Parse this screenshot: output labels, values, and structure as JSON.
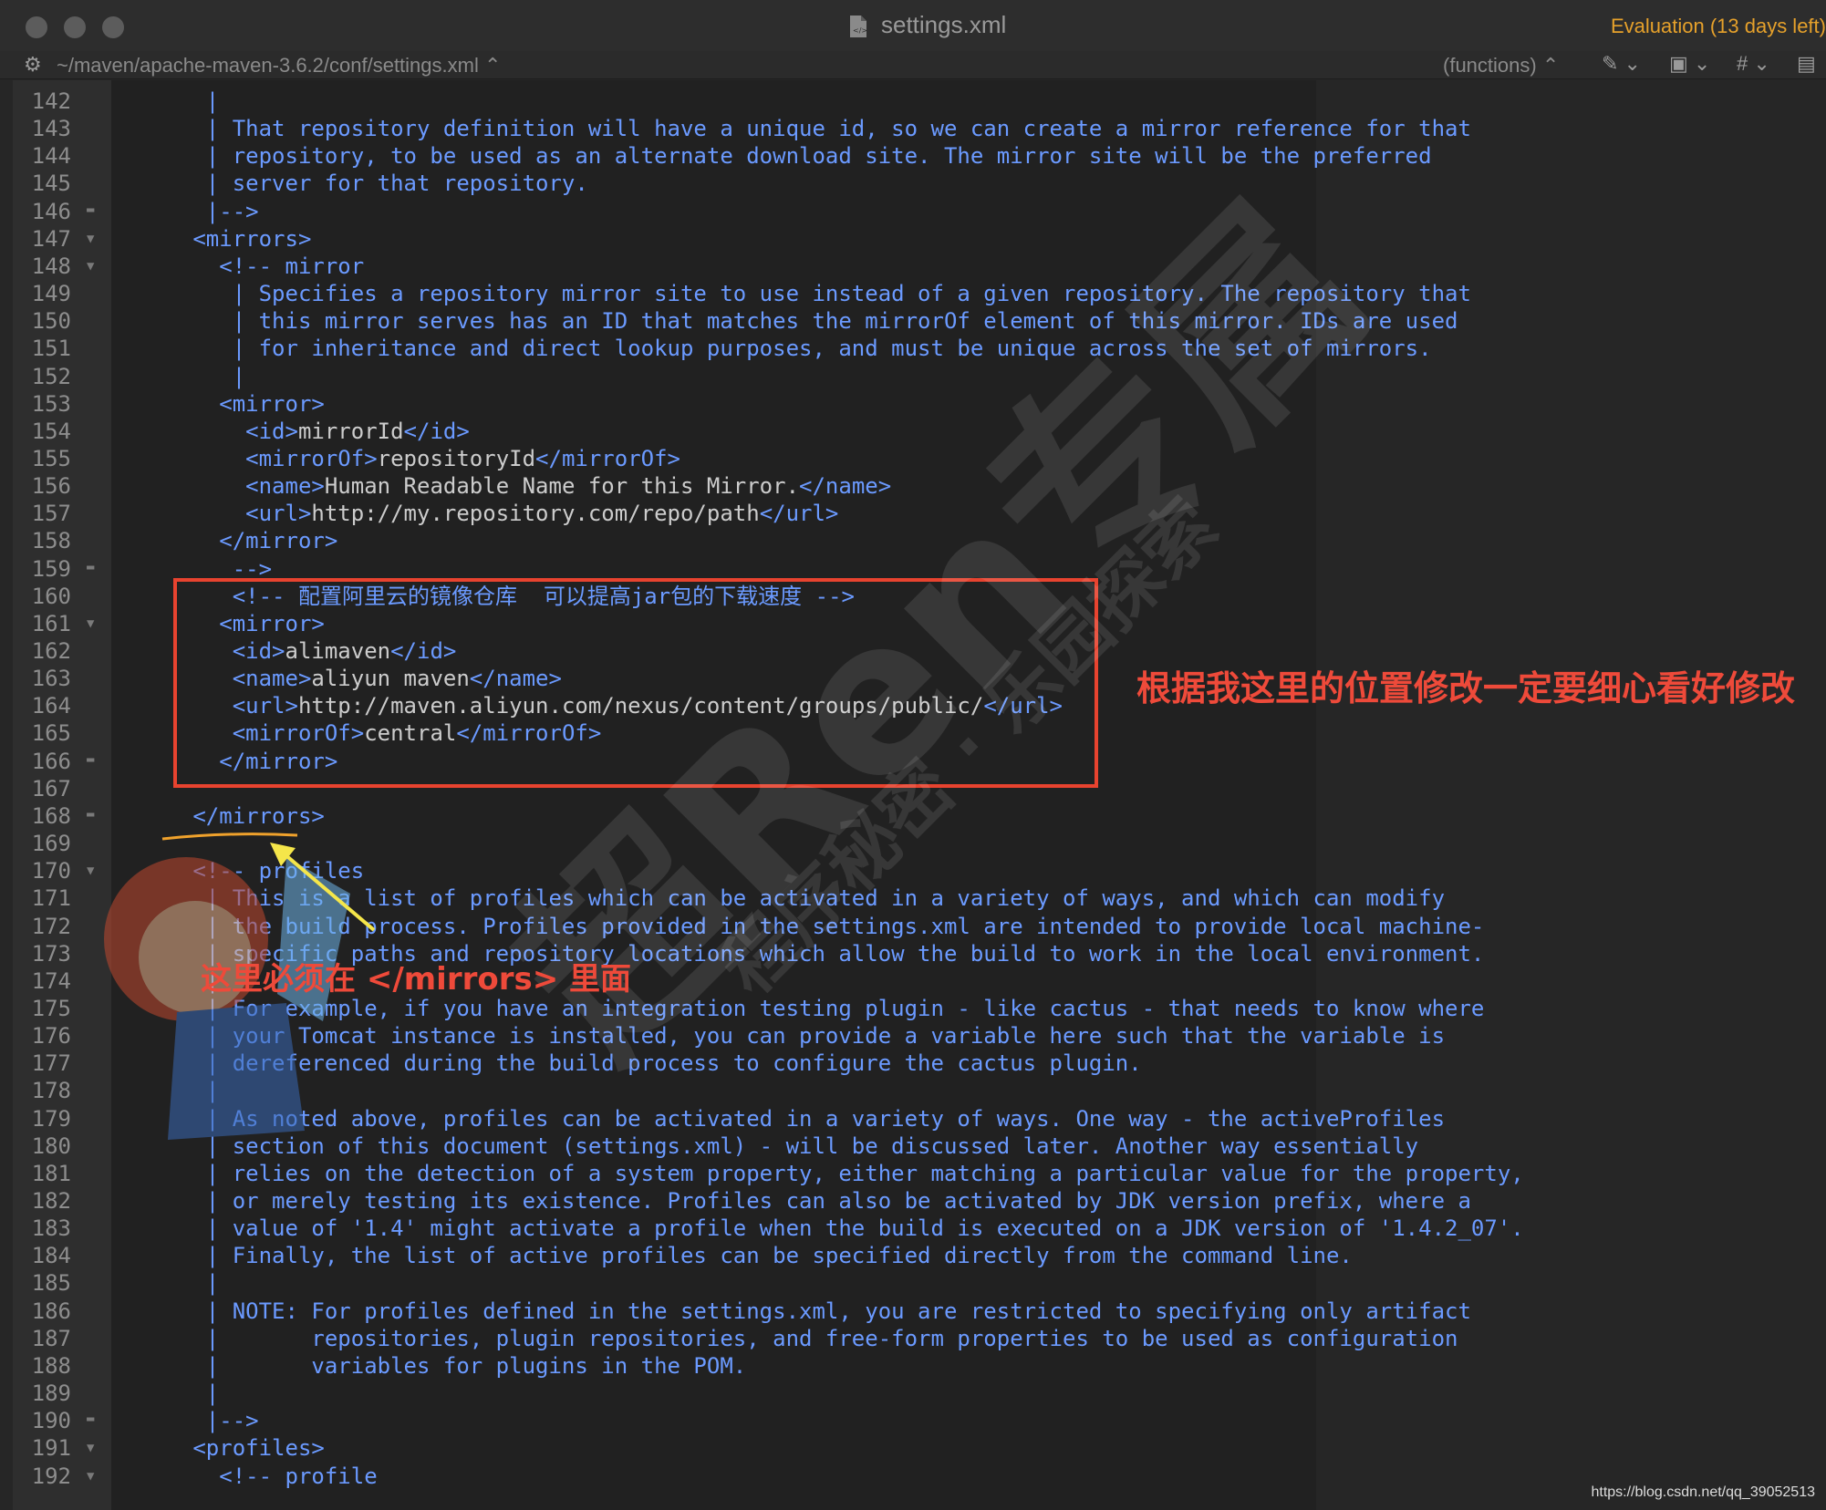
{
  "window": {
    "title": "settings.xml",
    "evaluation": "Evaluation (13 days left)"
  },
  "toolbar": {
    "path": "~/maven/apache-maven-3.6.2/conf/settings.xml",
    "functions": "(functions)"
  },
  "lines": [
    {
      "n": "142",
      "fold": "",
      "text": "    |"
    },
    {
      "n": "143",
      "fold": "",
      "text": "    | That repository definition will have a unique id, so we can create a mirror reference for that"
    },
    {
      "n": "144",
      "fold": "",
      "text": "    | repository, to be used as an alternate download site. The mirror site will be the preferred"
    },
    {
      "n": "145",
      "fold": "",
      "text": "    | server for that repository."
    },
    {
      "n": "146",
      "fold": "end",
      "text": "    |-->"
    },
    {
      "n": "147",
      "fold": "open",
      "text": "   <mirrors>"
    },
    {
      "n": "148",
      "fold": "open",
      "text": "     <!-- mirror"
    },
    {
      "n": "149",
      "fold": "",
      "text": "      | Specifies a repository mirror site to use instead of a given repository. The repository that"
    },
    {
      "n": "150",
      "fold": "",
      "text": "      | this mirror serves has an ID that matches the mirrorOf element of this mirror. IDs are used"
    },
    {
      "n": "151",
      "fold": "",
      "text": "      | for inheritance and direct lookup purposes, and must be unique across the set of mirrors."
    },
    {
      "n": "152",
      "fold": "",
      "text": "      |"
    },
    {
      "n": "153",
      "fold": "",
      "text": "     <mirror>"
    },
    {
      "n": "154",
      "fold": "",
      "text": "       <id>mirrorId</id>"
    },
    {
      "n": "155",
      "fold": "",
      "text": "       <mirrorOf>repositoryId</mirrorOf>"
    },
    {
      "n": "156",
      "fold": "",
      "text": "       <name>Human Readable Name for this Mirror.</name>"
    },
    {
      "n": "157",
      "fold": "",
      "text": "       <url>http://my.repository.com/repo/path</url>"
    },
    {
      "n": "158",
      "fold": "",
      "text": "     </mirror>"
    },
    {
      "n": "159",
      "fold": "end",
      "text": "      -->"
    },
    {
      "n": "160",
      "fold": "",
      "text": "      <!-- 配置阿里云的镜像仓库  可以提高jar包的下载速度 -->"
    },
    {
      "n": "161",
      "fold": "open",
      "text": "     <mirror>"
    },
    {
      "n": "162",
      "fold": "",
      "text": "      <id>alimaven</id>"
    },
    {
      "n": "163",
      "fold": "",
      "text": "      <name>aliyun maven</name>"
    },
    {
      "n": "164",
      "fold": "",
      "text": "      <url>http://maven.aliyun.com/nexus/content/groups/public/</url>"
    },
    {
      "n": "165",
      "fold": "",
      "text": "      <mirrorOf>central</mirrorOf>"
    },
    {
      "n": "166",
      "fold": "end",
      "text": "     </mirror>"
    },
    {
      "n": "167",
      "fold": "",
      "text": ""
    },
    {
      "n": "168",
      "fold": "end",
      "text": "   </mirrors>"
    },
    {
      "n": "169",
      "fold": "",
      "text": ""
    },
    {
      "n": "170",
      "fold": "open",
      "text": "   <!-- profiles"
    },
    {
      "n": "171",
      "fold": "",
      "text": "    | This is a list of profiles which can be activated in a variety of ways, and which can modify"
    },
    {
      "n": "172",
      "fold": "",
      "text": "    | the build process. Profiles provided in the settings.xml are intended to provide local machine-"
    },
    {
      "n": "173",
      "fold": "",
      "text": "    | specific paths and repository locations which allow the build to work in the local environment."
    },
    {
      "n": "174",
      "fold": "",
      "text": "    |"
    },
    {
      "n": "175",
      "fold": "",
      "text": "    | For example, if you have an integration testing plugin - like cactus - that needs to know where"
    },
    {
      "n": "176",
      "fold": "",
      "text": "    | your Tomcat instance is installed, you can provide a variable here such that the variable is"
    },
    {
      "n": "177",
      "fold": "",
      "text": "    | dereferenced during the build process to configure the cactus plugin."
    },
    {
      "n": "178",
      "fold": "",
      "text": "    |"
    },
    {
      "n": "179",
      "fold": "",
      "text": "    | As noted above, profiles can be activated in a variety of ways. One way - the activeProfiles"
    },
    {
      "n": "180",
      "fold": "",
      "text": "    | section of this document (settings.xml) - will be discussed later. Another way essentially"
    },
    {
      "n": "181",
      "fold": "",
      "text": "    | relies on the detection of a system property, either matching a particular value for the property,"
    },
    {
      "n": "182",
      "fold": "",
      "text": "    | or merely testing its existence. Profiles can also be activated by JDK version prefix, where a"
    },
    {
      "n": "183",
      "fold": "",
      "text": "    | value of '1.4' might activate a profile when the build is executed on a JDK version of '1.4.2_07'."
    },
    {
      "n": "184",
      "fold": "",
      "text": "    | Finally, the list of active profiles can be specified directly from the command line."
    },
    {
      "n": "185",
      "fold": "",
      "text": "    |"
    },
    {
      "n": "186",
      "fold": "",
      "text": "    | NOTE: For profiles defined in the settings.xml, you are restricted to specifying only artifact"
    },
    {
      "n": "187",
      "fold": "",
      "text": "    |       repositories, plugin repositories, and free-form properties to be used as configuration"
    },
    {
      "n": "188",
      "fold": "",
      "text": "    |       variables for plugins in the POM."
    },
    {
      "n": "189",
      "fold": "",
      "text": "    |"
    },
    {
      "n": "190",
      "fold": "end",
      "text": "    |-->"
    },
    {
      "n": "191",
      "fold": "open",
      "text": "   <profiles>"
    },
    {
      "n": "192",
      "fold": "open",
      "text": "     <!-- profile"
    }
  ],
  "annotations": {
    "right": "根据我这里的位置修改一定要细心看好修改",
    "left": "这里必须在   </mirrors> 里面"
  },
  "watermark": {
    "main": "超Ren专属",
    "sub": "程序秘密 · 乐园探索"
  },
  "footer": {
    "url": "https://blog.csdn.net/qq_39052513"
  }
}
